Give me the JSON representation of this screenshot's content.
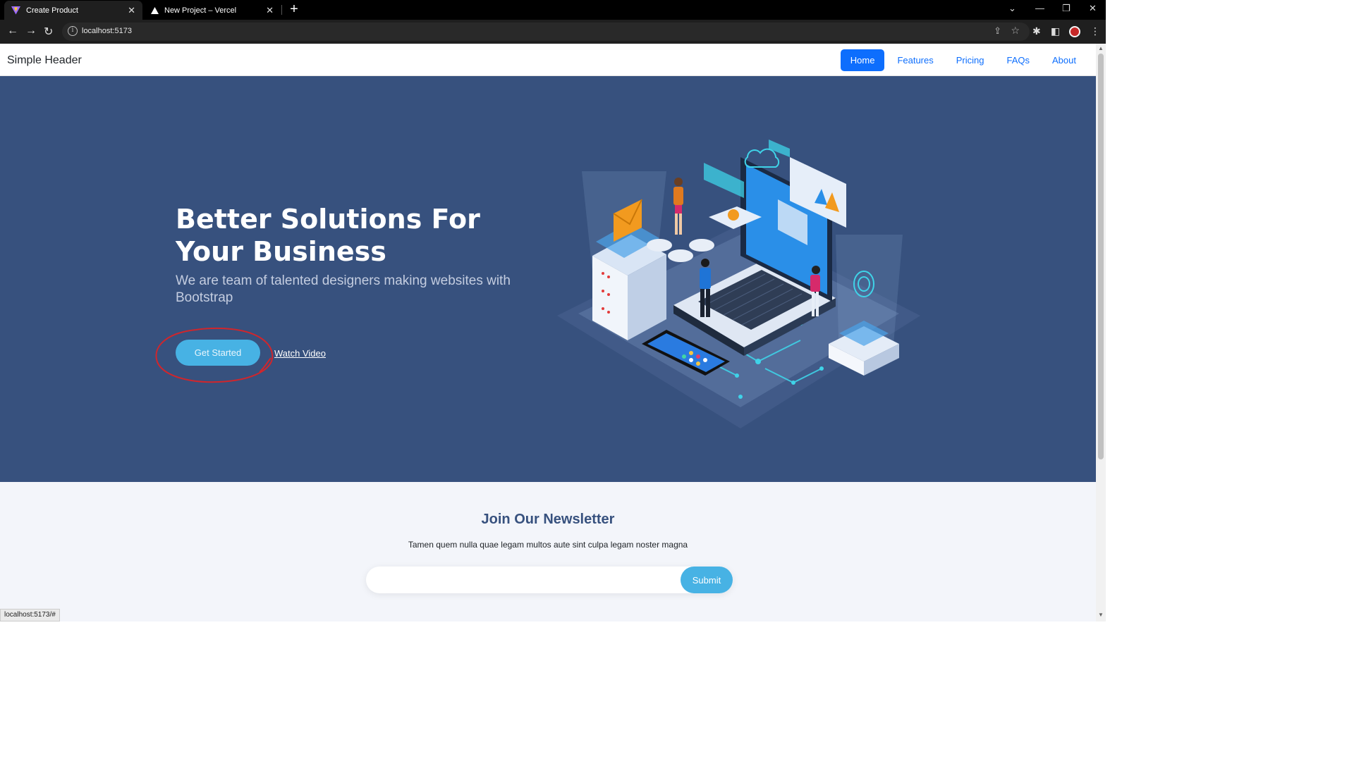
{
  "browser": {
    "tabs": [
      {
        "title": "Create Product",
        "icon": "vite-icon",
        "active": true
      },
      {
        "title": "New Project – Vercel",
        "icon": "vercel-icon",
        "active": false
      }
    ],
    "url": "localhost:5173",
    "status_url": "localhost:5173/#"
  },
  "header": {
    "brand": "Simple Header",
    "nav": [
      {
        "label": "Home",
        "active": true
      },
      {
        "label": "Features",
        "active": false
      },
      {
        "label": "Pricing",
        "active": false
      },
      {
        "label": "FAQs",
        "active": false
      },
      {
        "label": "About",
        "active": false
      }
    ]
  },
  "hero": {
    "title": "Better Solutions For Your Business",
    "subtitle": "We are team of talented designers making websites with Bootstrap",
    "primary_button": "Get Started",
    "secondary_link": "Watch Video"
  },
  "newsletter": {
    "title": "Join Our Newsletter",
    "text": "Tamen quem nulla quae legam multos aute sint culpa legam noster magna",
    "input_value": "",
    "submit_label": "Submit"
  },
  "colors": {
    "hero_bg": "#37517e",
    "accent": "#47b2e4",
    "nav_active": "#0d6efd",
    "annotation": "#d0262c"
  }
}
